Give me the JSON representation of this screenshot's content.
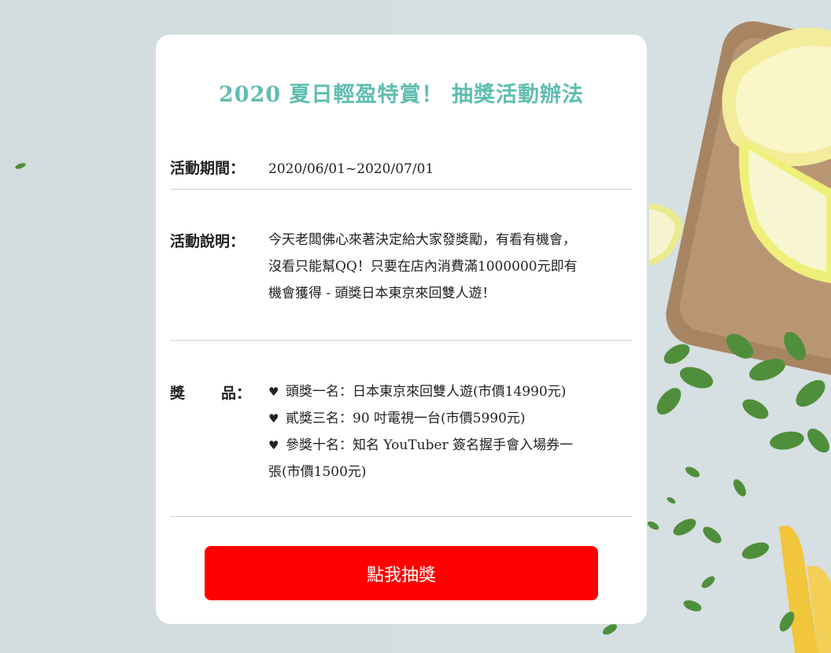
{
  "page": {
    "title": "2020 夏日輕盈特賞！ 抽獎活動辦法",
    "title_color": "#5fbdb2"
  },
  "period": {
    "label": "活動期間：",
    "value": "2020/06/01~2020/07/01"
  },
  "description": {
    "label": "活動說明：",
    "value": "今天老闆佛心來著決定給大家發獎勵，有看有機會，沒看只能幫QQ！只要在店內消費滿1000000元即有機會獲得 - 頭獎日本東京來回雙人遊！"
  },
  "prizes": {
    "label_char1": "獎",
    "label_char2": "品：",
    "items": [
      {
        "icon": "heart-icon",
        "text": "頭獎一名：日本東京來回雙人遊(市價14990元)"
      },
      {
        "icon": "heart-icon",
        "text": "貳獎三名：90 吋電視一台(市價5990元)"
      },
      {
        "icon": "heart-icon",
        "text": "參獎十名：知名 YouTuber 簽名握手會入場券一張(市價1500元)"
      }
    ]
  },
  "draw_button": {
    "label": "點我抽獎",
    "color": "#ff0000"
  }
}
